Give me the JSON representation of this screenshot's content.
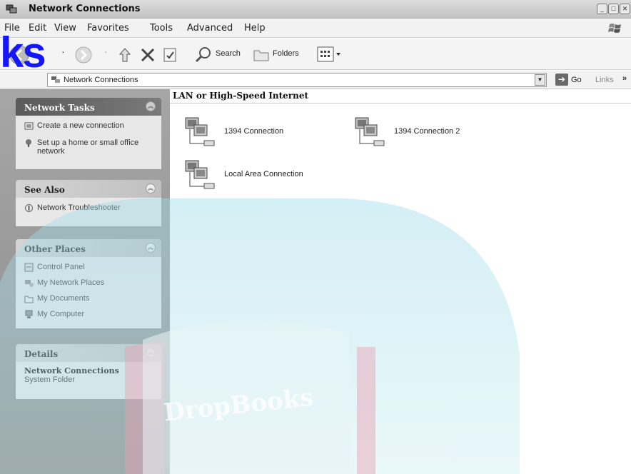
{
  "window": {
    "title": "Network Connections"
  },
  "menu": {
    "items": [
      "File",
      "Edit",
      "View",
      "Favorites",
      "Tools",
      "Advanced",
      "Help"
    ]
  },
  "toolbar": {
    "search_label": "Search",
    "folders_label": "Folders",
    "overlay_text": "ks"
  },
  "address": {
    "value": "Network Connections",
    "go_label": "Go",
    "links_label": "Links"
  },
  "sidebar": {
    "network_tasks": {
      "title": "Network Tasks",
      "items": [
        "Create a new connection",
        "Set up a home or small office network"
      ]
    },
    "see_also": {
      "title": "See Also",
      "items": [
        "Network Troubleshooter"
      ]
    },
    "other_places": {
      "title": "Other Places",
      "items": [
        "Control Panel",
        "My Network Places",
        "My Documents",
        "My Computer"
      ]
    },
    "details": {
      "title": "Details",
      "name": "Network Connections",
      "type": "System Folder"
    }
  },
  "content": {
    "group_title": "LAN or High-Speed Internet",
    "connections": [
      "1394 Connection",
      "1394 Connection 2",
      "Local Area Connection"
    ]
  },
  "watermark": {
    "text": "DropBooks"
  }
}
